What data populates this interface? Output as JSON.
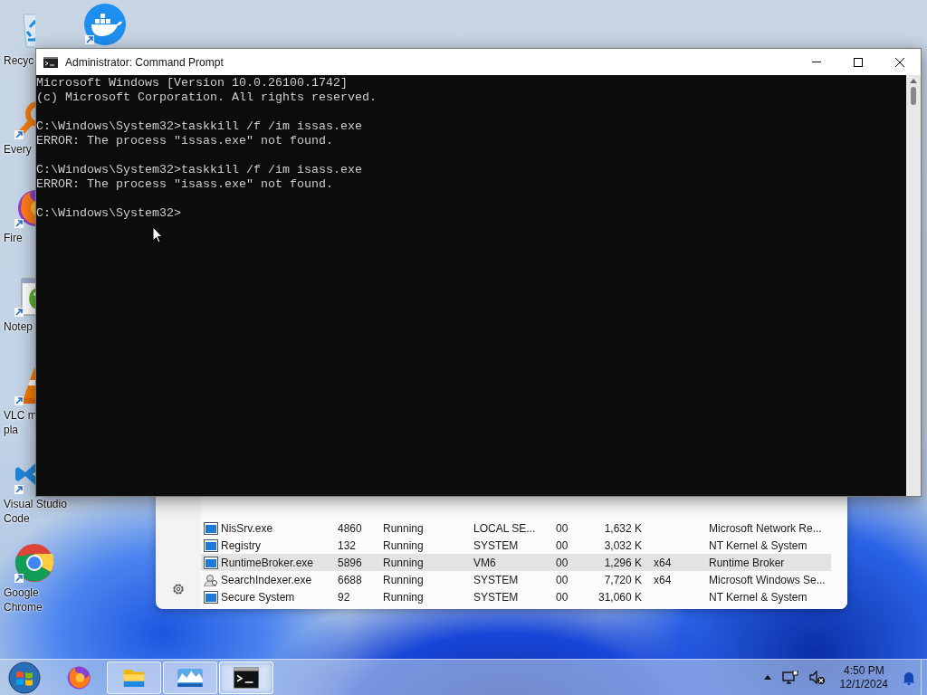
{
  "desktop_icons": [
    {
      "kind": "recycle",
      "lines": [
        "Recyc"
      ]
    },
    {
      "kind": "search",
      "lines": [
        "Every"
      ]
    },
    {
      "kind": "firefox",
      "lines": [
        "Fire"
      ]
    },
    {
      "kind": "notepad",
      "lines": [
        "Notep"
      ]
    },
    {
      "kind": "vlc",
      "lines": [
        "VLC m",
        "pla"
      ]
    },
    {
      "kind": "vscode",
      "lines": [
        "Visual Studio",
        "Code"
      ]
    },
    {
      "kind": "chrome",
      "lines": [
        "Google",
        "Chrome"
      ]
    },
    {
      "kind": "docker"
    }
  ],
  "task_manager": {
    "rows": [
      {
        "kind": "app",
        "selected": false,
        "name": "NisSrv.exe",
        "pid": "4860",
        "status": "Running",
        "user": "LOCAL SE...",
        "cpu": "00",
        "memory": "1,632 K",
        "description": "Microsoft Network Re..."
      },
      {
        "kind": "app",
        "selected": false,
        "name": "Registry",
        "pid": "132",
        "status": "Running",
        "user": "SYSTEM",
        "cpu": "00",
        "memory": "3,032 K",
        "description": "NT Kernel & System"
      },
      {
        "kind": "app",
        "selected": true,
        "name": "RuntimeBroker.exe",
        "pid": "5896",
        "status": "Running",
        "user": "VM6",
        "cpu": "00",
        "memory": "1,296 K",
        "arch": "x64",
        "description": "Runtime Broker"
      },
      {
        "kind": "search",
        "selected": false,
        "name": "SearchIndexer.exe",
        "pid": "6688",
        "status": "Running",
        "user": "SYSTEM",
        "cpu": "00",
        "memory": "7,720 K",
        "arch": "x64",
        "description": "Microsoft Windows Se..."
      },
      {
        "kind": "app",
        "selected": false,
        "name": "Secure System",
        "pid": "92",
        "status": "Running",
        "user": "SYSTEM",
        "cpu": "00",
        "memory": "31,060 K",
        "description": "NT Kernel & System"
      }
    ]
  },
  "console": {
    "title": "Administrator: Command Prompt",
    "blocks": [
      [
        "Microsoft Windows [Version 10.0.26100.1742]",
        "(c) Microsoft Corporation. All rights reserved."
      ],
      [
        "C:\\Windows\\System32>taskkill /f /im issas.exe",
        "ERROR: The process \"issas.exe\" not found."
      ],
      [
        "C:\\Windows\\System32>taskkill /f /im isass.exe",
        "ERROR: The process \"isass.exe\" not found."
      ],
      [
        "C:\\Windows\\System32>"
      ]
    ]
  },
  "taskbar": {
    "apps": [
      {
        "kind": "firefox",
        "running": false,
        "selected": false
      },
      {
        "kind": "explorer",
        "running": true,
        "selected": false
      },
      {
        "kind": "taskmgr",
        "running": true,
        "selected": false
      },
      {
        "kind": "cmd",
        "running": true,
        "selected": true
      }
    ],
    "time": "4:50 PM",
    "date": "12/1/2024"
  }
}
